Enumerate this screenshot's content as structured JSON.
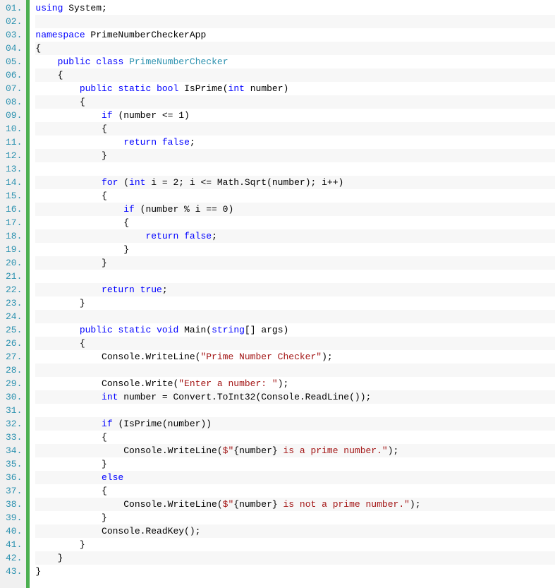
{
  "lineNumbers": [
    "01.",
    "02.",
    "03.",
    "04.",
    "05.",
    "06.",
    "07.",
    "08.",
    "09.",
    "10.",
    "11.",
    "12.",
    "13.",
    "14.",
    "15.",
    "16.",
    "17.",
    "18.",
    "19.",
    "20.",
    "21.",
    "22.",
    "23.",
    "24.",
    "25.",
    "26.",
    "27.",
    "28.",
    "29.",
    "30.",
    "31.",
    "32.",
    "33.",
    "34.",
    "35.",
    "36.",
    "37.",
    "38.",
    "39.",
    "40.",
    "41.",
    "42.",
    "43."
  ],
  "code": [
    [
      [
        "k",
        "using"
      ],
      [
        "p",
        " System;"
      ]
    ],
    [],
    [
      [
        "k",
        "namespace"
      ],
      [
        "p",
        " PrimeNumberCheckerApp"
      ]
    ],
    [
      [
        "p",
        "{"
      ]
    ],
    [
      [
        "p",
        "    "
      ],
      [
        "k",
        "public"
      ],
      [
        "p",
        " "
      ],
      [
        "k",
        "class"
      ],
      [
        "p",
        " "
      ],
      [
        "t",
        "PrimeNumberChecker"
      ]
    ],
    [
      [
        "p",
        "    {"
      ]
    ],
    [
      [
        "p",
        "        "
      ],
      [
        "k",
        "public"
      ],
      [
        "p",
        " "
      ],
      [
        "k",
        "static"
      ],
      [
        "p",
        " "
      ],
      [
        "k",
        "bool"
      ],
      [
        "p",
        " IsPrime("
      ],
      [
        "k",
        "int"
      ],
      [
        "p",
        " number)"
      ]
    ],
    [
      [
        "p",
        "        {"
      ]
    ],
    [
      [
        "p",
        "            "
      ],
      [
        "k",
        "if"
      ],
      [
        "p",
        " (number <= 1)"
      ]
    ],
    [
      [
        "p",
        "            {"
      ]
    ],
    [
      [
        "p",
        "                "
      ],
      [
        "k",
        "return"
      ],
      [
        "p",
        " "
      ],
      [
        "k",
        "false"
      ],
      [
        "p",
        ";"
      ]
    ],
    [
      [
        "p",
        "            }"
      ]
    ],
    [],
    [
      [
        "p",
        "            "
      ],
      [
        "k",
        "for"
      ],
      [
        "p",
        " ("
      ],
      [
        "k",
        "int"
      ],
      [
        "p",
        " i = 2; i <= Math.Sqrt(number); i++)"
      ]
    ],
    [
      [
        "p",
        "            {"
      ]
    ],
    [
      [
        "p",
        "                "
      ],
      [
        "k",
        "if"
      ],
      [
        "p",
        " (number % i == 0)"
      ]
    ],
    [
      [
        "p",
        "                {"
      ]
    ],
    [
      [
        "p",
        "                    "
      ],
      [
        "k",
        "return"
      ],
      [
        "p",
        " "
      ],
      [
        "k",
        "false"
      ],
      [
        "p",
        ";"
      ]
    ],
    [
      [
        "p",
        "                }"
      ]
    ],
    [
      [
        "p",
        "            }"
      ]
    ],
    [],
    [
      [
        "p",
        "            "
      ],
      [
        "k",
        "return"
      ],
      [
        "p",
        " "
      ],
      [
        "k",
        "true"
      ],
      [
        "p",
        ";"
      ]
    ],
    [
      [
        "p",
        "        }"
      ]
    ],
    [],
    [
      [
        "p",
        "        "
      ],
      [
        "k",
        "public"
      ],
      [
        "p",
        " "
      ],
      [
        "k",
        "static"
      ],
      [
        "p",
        " "
      ],
      [
        "k",
        "void"
      ],
      [
        "p",
        " Main("
      ],
      [
        "k",
        "string"
      ],
      [
        "p",
        "[] args)"
      ]
    ],
    [
      [
        "p",
        "        {"
      ]
    ],
    [
      [
        "p",
        "            Console.WriteLine("
      ],
      [
        "s",
        "\"Prime Number Checker\""
      ],
      [
        "p",
        ");"
      ]
    ],
    [],
    [
      [
        "p",
        "            Console.Write("
      ],
      [
        "s",
        "\"Enter a number: \""
      ],
      [
        "p",
        ");"
      ]
    ],
    [
      [
        "p",
        "            "
      ],
      [
        "k",
        "int"
      ],
      [
        "p",
        " number = Convert.ToInt32(Console.ReadLine());"
      ]
    ],
    [],
    [
      [
        "p",
        "            "
      ],
      [
        "k",
        "if"
      ],
      [
        "p",
        " (IsPrime(number))"
      ]
    ],
    [
      [
        "p",
        "            {"
      ]
    ],
    [
      [
        "p",
        "                Console.WriteLine("
      ],
      [
        "s",
        "$\""
      ],
      [
        "p",
        "{number}"
      ],
      [
        "s",
        " is a prime number.\""
      ],
      [
        "p",
        ");"
      ]
    ],
    [
      [
        "p",
        "            }"
      ]
    ],
    [
      [
        "p",
        "            "
      ],
      [
        "k",
        "else"
      ]
    ],
    [
      [
        "p",
        "            {"
      ]
    ],
    [
      [
        "p",
        "                Console.WriteLine("
      ],
      [
        "s",
        "$\""
      ],
      [
        "p",
        "{number}"
      ],
      [
        "s",
        " is not a prime number.\""
      ],
      [
        "p",
        ");"
      ]
    ],
    [
      [
        "p",
        "            }"
      ]
    ],
    [
      [
        "p",
        "            Console.ReadKey();"
      ]
    ],
    [
      [
        "p",
        "        }"
      ]
    ],
    [
      [
        "p",
        "    }"
      ]
    ],
    [
      [
        "p",
        "}"
      ]
    ]
  ]
}
